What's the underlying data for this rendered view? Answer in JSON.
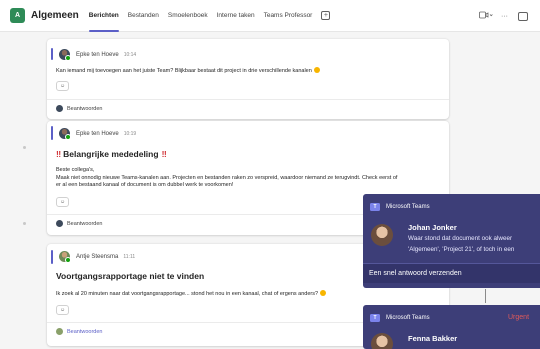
{
  "header": {
    "team_initial": "A",
    "channel": "Algemeen",
    "tabs": [
      "Berichten",
      "Bestanden",
      "Smoelenboek",
      "Interne taken",
      "Teams Professor"
    ],
    "add_tab": "+",
    "icons": [
      "video-dropdown-icon",
      "more-icon",
      "expand-icon"
    ],
    "more": "···"
  },
  "posts": [
    {
      "author": "Epke ten Hoeve",
      "time": "10:14",
      "message": "Kan iemand mij toevoegen aan het juiste Team? Blijkbaar bestaat dit project in drie verschillende kanalen",
      "reply": "Beantwoorden"
    },
    {
      "author": "Epke ten Hoeve",
      "time": "10:19",
      "title_mark": "‼",
      "title": "Belangrijke mededeling",
      "message_line1": "Beste collega's,",
      "message_line2": "Maak niet onnodig nieuwe Teams-kanalen aan. Projecten en bestanden raken zo verspreid, waardoor niemand ze terugvindt. Check eerst of",
      "message_line3": "er al een bestaand kanaal of document is om dubbel werk te voorkomen!",
      "reply": "Beantwoorden"
    },
    {
      "author": "Antje Steensma",
      "time": "11:11",
      "title": "Voortgangsrapportage niet te vinden",
      "message": "Ik zoek al 20 minuten naar dat voortgangsrapportage... stond het nou in een kanaal, chat of ergens anders?",
      "reply": "Beantwoorden"
    }
  ],
  "reaction_icon": "smiley-add-icon",
  "reaction_glyph": "☺",
  "toasts": [
    {
      "app": "Microsoft Teams",
      "sender": "Johan Jonker",
      "line1": "Waar stond dat document ook alweer",
      "line2": "'Algemeen', 'Project 21', of toch in een",
      "quick_reply": "Een snel antwoord verzenden"
    },
    {
      "app": "Microsoft Teams",
      "urgent": "Urgent",
      "sender": "Fenna Bakker"
    }
  ],
  "colors": {
    "accent": "#5b5fc7",
    "toast_bg": "#3d3e78",
    "urgent": "#e05a5a",
    "online": "#13a10e"
  }
}
